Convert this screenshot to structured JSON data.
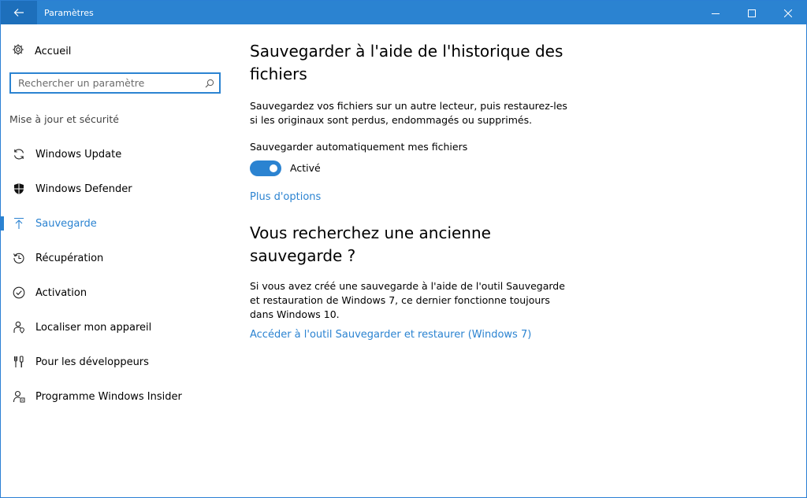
{
  "titlebar": {
    "title": "Paramètres",
    "back_icon": "back-arrow-icon",
    "controls": [
      "minimize-icon",
      "maximize-icon",
      "close-icon"
    ]
  },
  "sidebar": {
    "home": {
      "label": "Accueil",
      "icon": "gear-icon"
    },
    "search": {
      "placeholder": "Rechercher un paramètre",
      "icon": "search-icon"
    },
    "section_label": "Mise à jour et sécurité",
    "items": [
      {
        "label": "Windows Update",
        "icon": "sync-icon"
      },
      {
        "label": "Windows Defender",
        "icon": "shield-icon"
      },
      {
        "label": "Sauvegarde",
        "icon": "upload-arrow-icon",
        "active": true
      },
      {
        "label": "Récupération",
        "icon": "history-icon"
      },
      {
        "label": "Activation",
        "icon": "check-circle-icon"
      },
      {
        "label": "Localiser mon appareil",
        "icon": "person-location-icon"
      },
      {
        "label": "Pour les développeurs",
        "icon": "developer-tools-icon"
      },
      {
        "label": "Programme Windows Insider",
        "icon": "insider-person-icon"
      }
    ]
  },
  "main": {
    "title": "Sauvegarder à l'aide de l'historique des fichiers",
    "description": "Sauvegardez vos fichiers sur un autre lecteur, puis restaurez-les si les originaux sont perdus, endommagés ou supprimés.",
    "toggle_label": "Sauvegarder automatiquement mes fichiers",
    "toggle_state": "Activé",
    "toggle_on": true,
    "more_options_link": "Plus d'options",
    "section2_title": "Vous recherchez une ancienne sauvegarde ?",
    "section2_description": "Si vous avez créé une sauvegarde à l'aide de l'outil Sauvegarde et restauration de Windows 7, ce dernier fonctionne toujours dans Windows 10.",
    "section2_link": "Accéder à l'outil Sauvegarder et restaurer (Windows 7)"
  },
  "colors": {
    "accent": "#2b83d1",
    "titlebar": "#2b83d1",
    "back_button": "#1d6fbb"
  }
}
